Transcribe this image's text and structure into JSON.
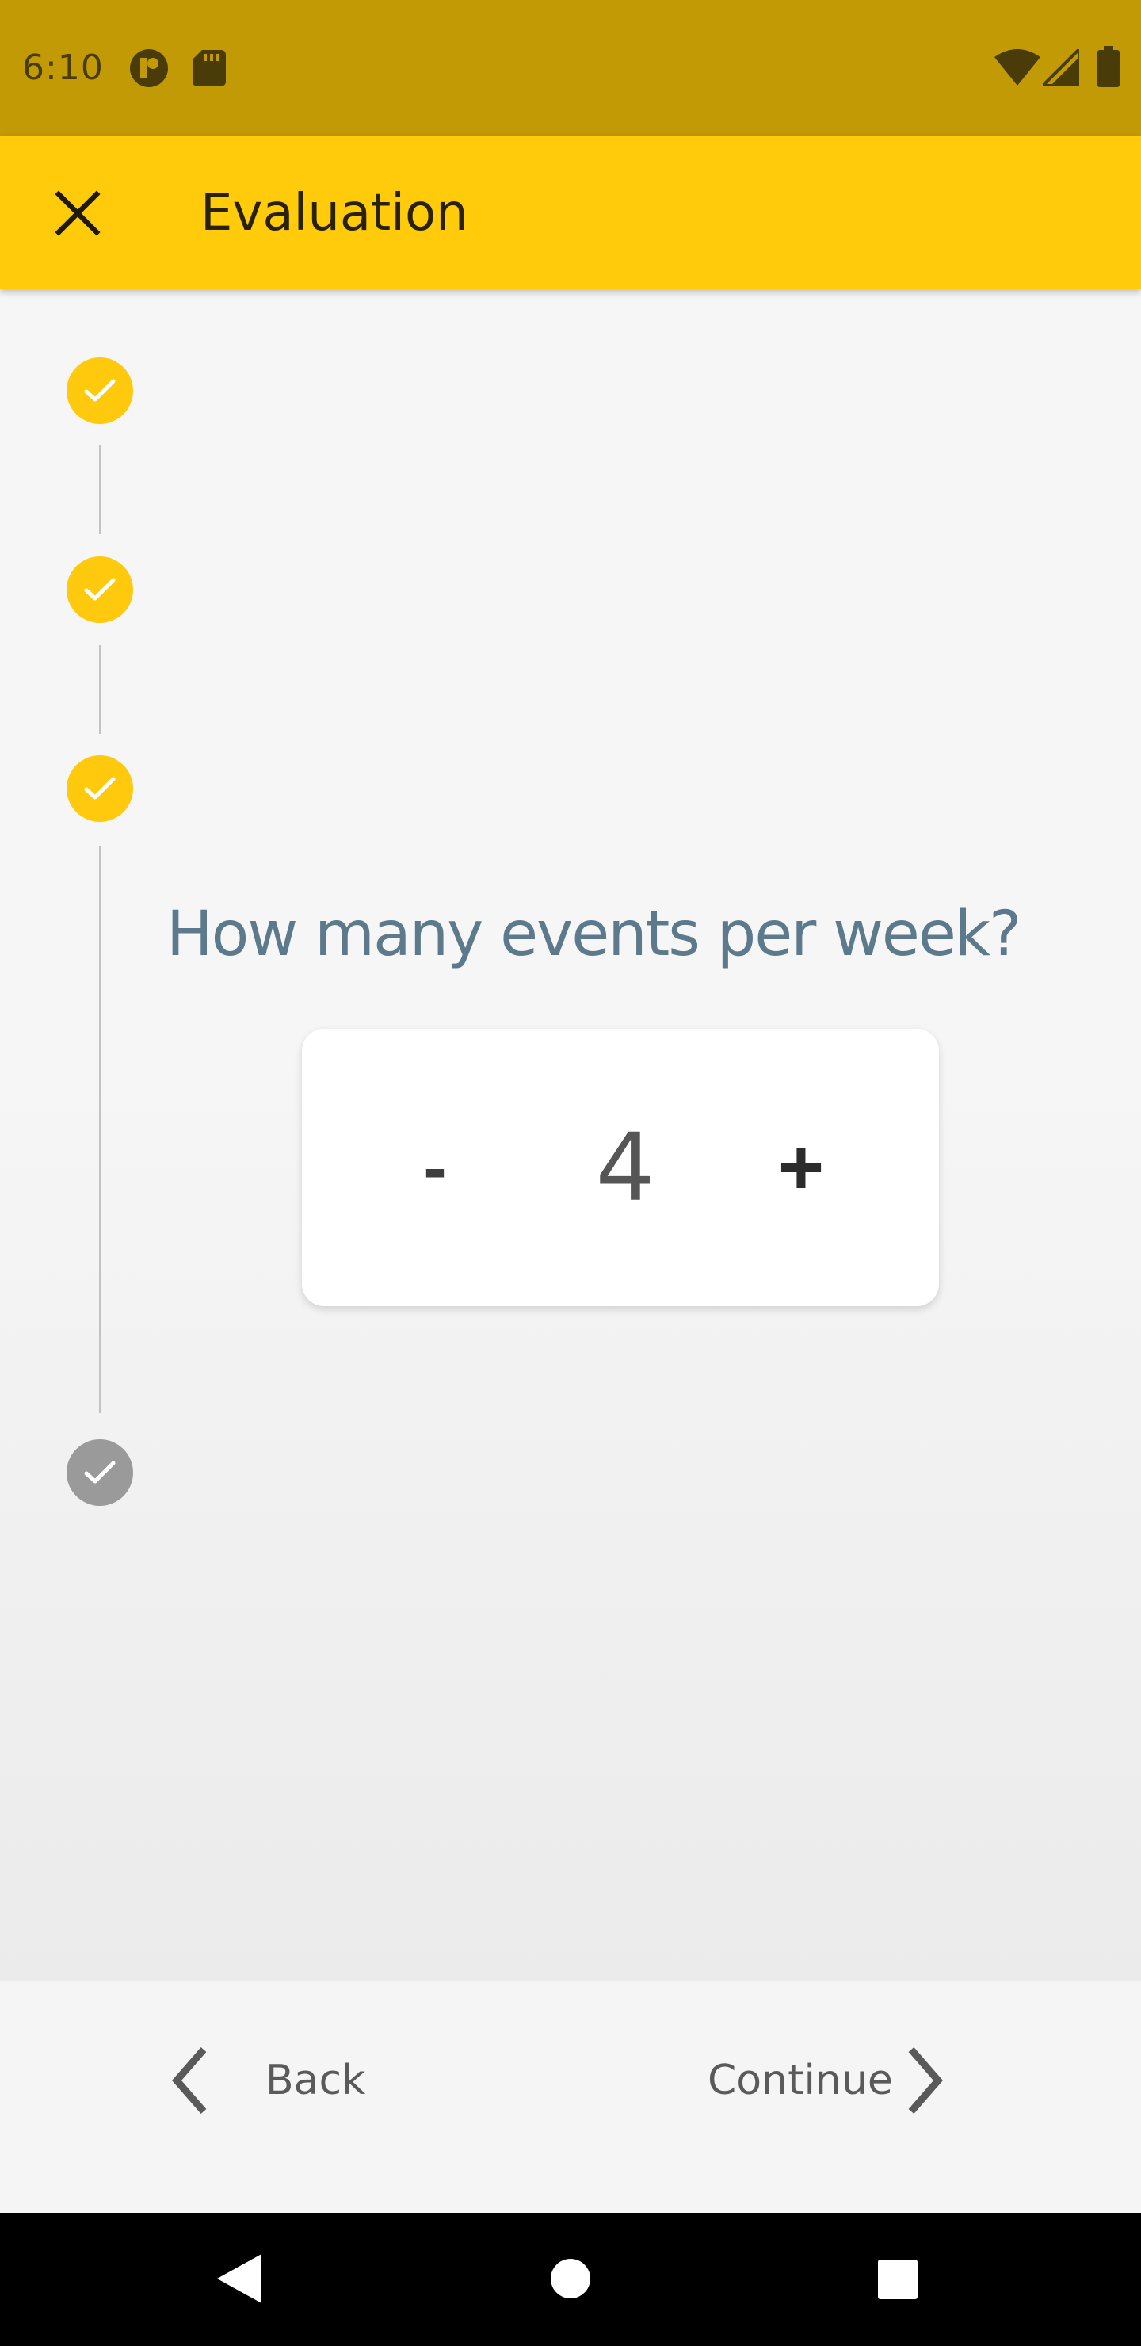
{
  "status_bar": {
    "time": "6:10",
    "left_icons": [
      "notification-icon",
      "sd-card-icon"
    ],
    "right_icons": [
      "wifi-icon",
      "signal-icon",
      "battery-icon"
    ]
  },
  "app_bar": {
    "title": "Evaluation",
    "close_icon": "close-icon",
    "color": "#ffcb0b"
  },
  "stepper_progress": {
    "steps": [
      {
        "status": "done"
      },
      {
        "status": "done"
      },
      {
        "status": "done"
      },
      {
        "status": "pending"
      }
    ],
    "done_color": "#ffc90d",
    "pending_color": "#9a9a9a"
  },
  "question": {
    "text": "How many events per week?",
    "color": "#5d7a8c"
  },
  "counter": {
    "decrement_label": "-",
    "value": "4",
    "increment_label": "+"
  },
  "footer": {
    "back_label": "Back",
    "continue_label": "Continue"
  },
  "nav_bar": {
    "icons": [
      "back-triangle-icon",
      "home-circle-icon",
      "recents-square-icon"
    ]
  }
}
